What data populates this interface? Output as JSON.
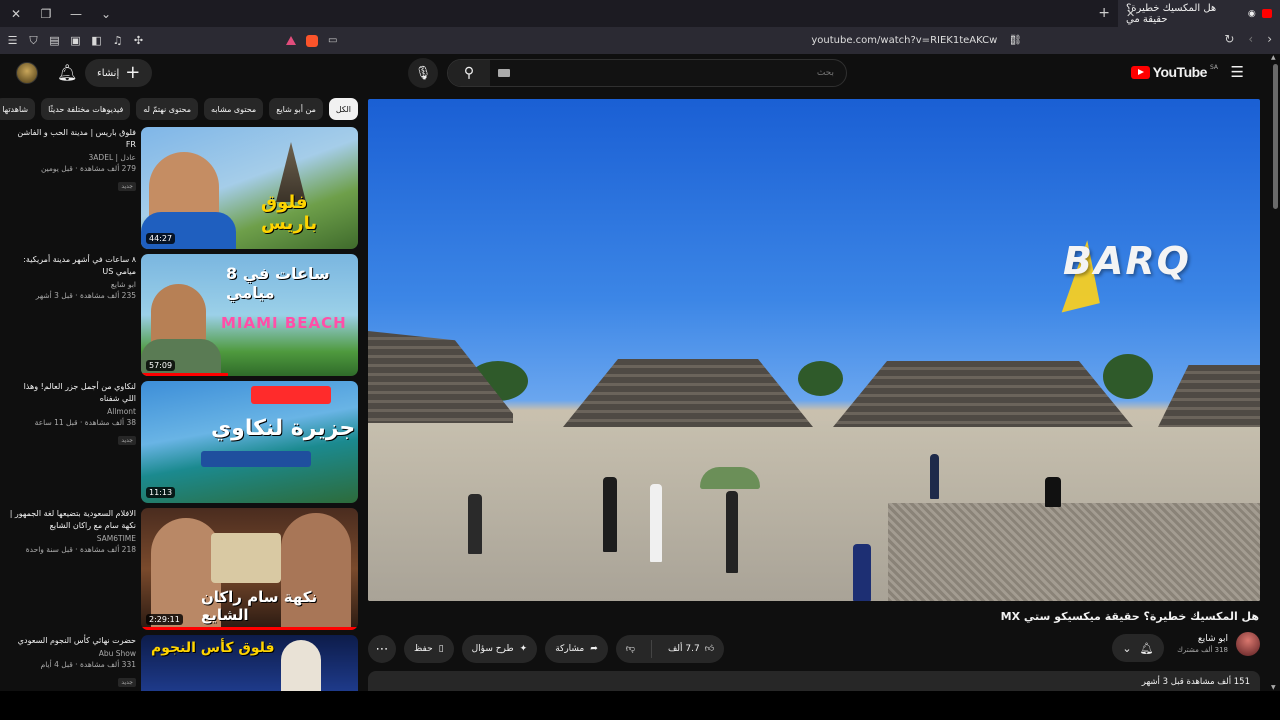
{
  "browser": {
    "tab_title": "هل المكسيك خطيرة؟ حقيقة مي",
    "url": "youtube.com/watch?v=RIEK1teAKCw"
  },
  "header": {
    "create_label": "إنشاء",
    "search_placeholder": "بحث",
    "logo_text": "YouTube",
    "logo_region": "SA"
  },
  "chips": [
    "الكل",
    "من أبو شايع",
    "محتوى مشابه",
    "محتوى نهتمّ له",
    "فيديوهات مختلفة حديثًا",
    "شاهدتها"
  ],
  "recommendations": [
    {
      "title": "فلوق باريس | مدينة الحب و الفاشن FR",
      "channel": "عادل | 3ADEL",
      "stats": "279 ألف مشاهدة · قبل يومين",
      "badge": "جديد",
      "duration": "44:27",
      "thumb_text": "فلوق باريس"
    },
    {
      "title": "٨ ساعات في أشهر مدينة أمريكية: ميامي US",
      "channel": "ابو شايع",
      "stats": "235 ألف مشاهدة · قبل 3 أشهر",
      "badge": "",
      "duration": "57:09",
      "thumb_text": "8 ساعات في ميامي"
    },
    {
      "title": "لنكاوي من أجمل جزر العالم! وهذا اللي شفناه",
      "channel": "Allmont",
      "stats": "38 ألف مشاهدة · قبل 11 ساعة",
      "badge": "جديد",
      "duration": "11:13",
      "thumb_text": "جزيرة لنكاوي"
    },
    {
      "title": "الافلام السعودية بتضيعها لغة الجمهور | نكهة سام مع راكان الشايع",
      "channel": "SAM6TIME",
      "stats": "218 ألف مشاهدة · قبل سنة واحدة",
      "badge": "",
      "duration": "2:29:11",
      "thumb_text": "نكهة سام راكان الشايع"
    },
    {
      "title": "حضرت نهائي كأس النجوم السعودي",
      "channel": "Abu Show",
      "stats": "331 ألف مشاهدة · قبل 4 أيام",
      "badge": "جديد",
      "duration": "",
      "thumb_text": "فلوق كأس النجوم"
    }
  ],
  "video": {
    "title": "هل المكسيك خطيرة؟ حقيقة ميكسيكو ستي MX",
    "watermark": "BARQ",
    "owner_name": "ابو شايع",
    "owner_subs": "318 ألف مشترك",
    "likes": "7.7 ألف",
    "share_label": "مشاركة",
    "ask_label": "طرح سؤال",
    "save_label": "حفظ",
    "views_line": "151 ألف مشاهدة قبل 3 أشهر"
  },
  "colors": {
    "accent": "#ff0000",
    "background": "#0f0f0f",
    "surface": "#272727"
  }
}
